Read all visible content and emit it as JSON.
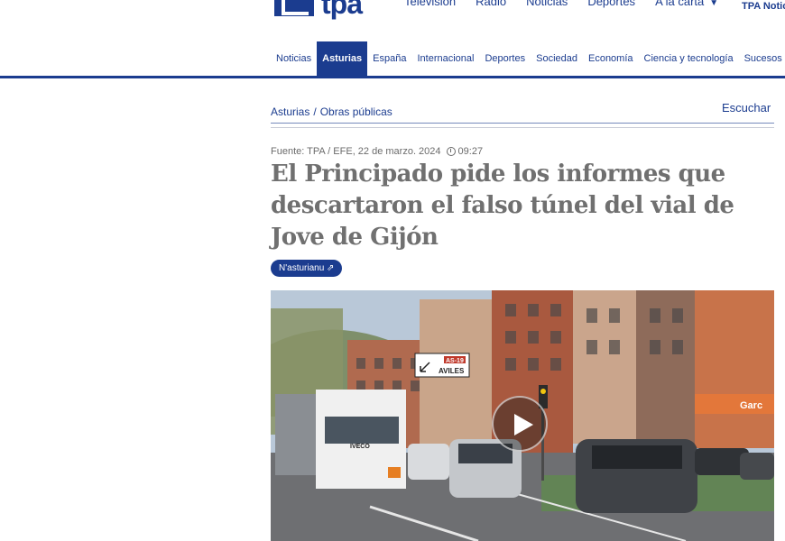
{
  "header": {
    "logo_text": "tpa",
    "top_nav": [
      "Televisión",
      "Radio",
      "Noticias",
      "Deportes",
      "A la carta"
    ],
    "brand_link": "TPA Noticias"
  },
  "section_nav": {
    "items": [
      "Noticias",
      "Asturias",
      "España",
      "Internacional",
      "Deportes",
      "Sociedad",
      "Economía",
      "Ciencia y tecnología",
      "Sucesos"
    ],
    "active": "Asturias"
  },
  "breadcrumb": {
    "section": "Asturias",
    "separator": "/",
    "subsection": "Obras públicas"
  },
  "listen_label": "Escuchar",
  "article": {
    "source": "Fuente: TPA / EFE, 22 de marzo. 2024",
    "time": "09:27",
    "title": "El Principado pide los informes que descartaron el falso túnel del vial de Jove de Gijón",
    "language_badge": "N'asturianu ⇗"
  },
  "video": {
    "road_sign_code": "AS-19",
    "road_sign_text": "AVILES",
    "truck_brand": "IVECO",
    "shop_sign": "Garc"
  },
  "colors": {
    "brand": "#1b3c8f",
    "headline": "#707070",
    "meta": "#6b6b6b"
  }
}
